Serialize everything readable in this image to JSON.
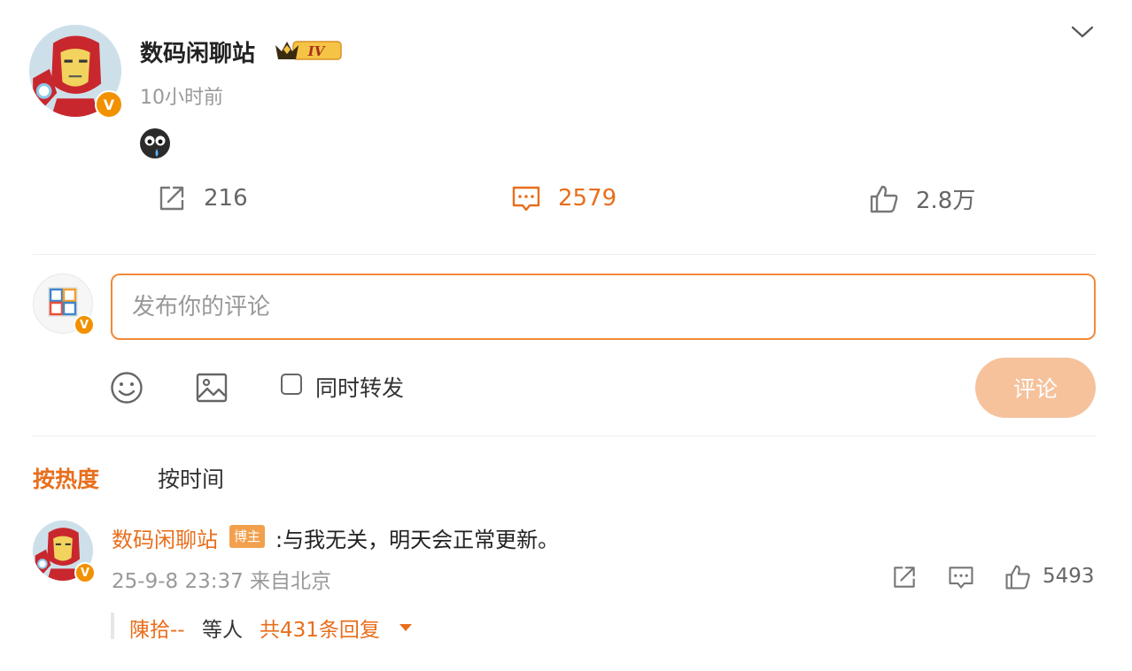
{
  "post": {
    "author": "数码闲聊站",
    "level_badge": "IV",
    "verified_mark": "V",
    "time": "10小时前",
    "body_icon": "crying-face-emoji",
    "menu_icon": "chevron-down-icon"
  },
  "actions": {
    "forward_count": "216",
    "comment_count": "2579",
    "like_count": "2.8万"
  },
  "composer": {
    "placeholder": "发布你的评论",
    "value": "",
    "repost_label": "同时转发",
    "repost_checked": false,
    "submit_label": "评论",
    "user_verified_mark": "V"
  },
  "sort": {
    "hot_label": "按热度",
    "time_label": "按时间",
    "active": "hot"
  },
  "comments": [
    {
      "author": "数码闲聊站",
      "badge": "博主",
      "text": ":与我无关，明天会正常更新。",
      "meta": "25-9-8 23:37 来自北京",
      "like_count": "5493",
      "verified_mark": "V",
      "reply_preview": {
        "user": "陳拾--",
        "middle": "等人",
        "total": "共431条回复"
      }
    }
  ],
  "colors": {
    "accent": "#e86e1c",
    "verified": "#f29100",
    "submit_disabled": "#f5c29c"
  }
}
